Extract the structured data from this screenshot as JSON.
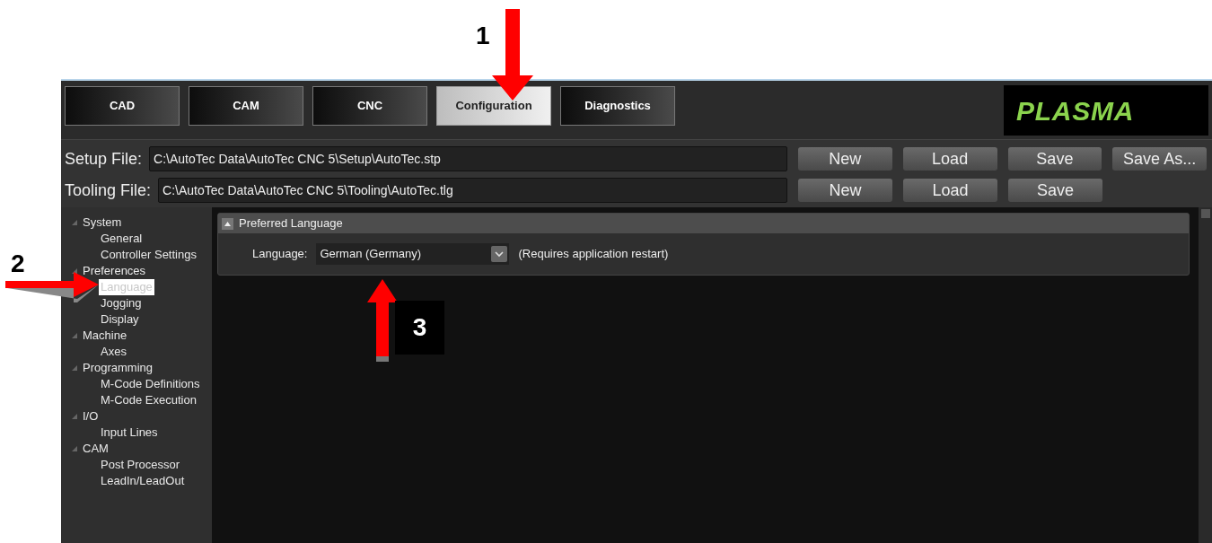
{
  "tabs": [
    {
      "label": "CAD",
      "selected": false
    },
    {
      "label": "CAM",
      "selected": false
    },
    {
      "label": "CNC",
      "selected": false
    },
    {
      "label": "Configuration",
      "selected": true
    },
    {
      "label": "Diagnostics",
      "selected": false
    }
  ],
  "logo": "PLASMA",
  "files": [
    {
      "label": "Setup File:",
      "path": "C:\\AutoTec Data\\AutoTec CNC 5\\Setup\\AutoTec.stp",
      "buttons": [
        "New",
        "Load",
        "Save",
        "Save As..."
      ]
    },
    {
      "label": "Tooling File:",
      "path": "C:\\AutoTec Data\\AutoTec CNC 5\\Tooling\\AutoTec.tlg",
      "buttons": [
        "New",
        "Load",
        "Save"
      ]
    }
  ],
  "tree": [
    {
      "label": "System",
      "expanded": true,
      "children": [
        {
          "label": "General",
          "selected": false
        },
        {
          "label": "Controller Settings",
          "selected": false
        }
      ]
    },
    {
      "label": "Preferences",
      "expanded": true,
      "children": [
        {
          "label": "Language",
          "selected": true
        },
        {
          "label": "Jogging",
          "selected": false
        },
        {
          "label": "Display",
          "selected": false
        }
      ]
    },
    {
      "label": "Machine",
      "expanded": true,
      "children": [
        {
          "label": "Axes",
          "selected": false
        }
      ]
    },
    {
      "label": "Programming",
      "expanded": true,
      "children": [
        {
          "label": "M-Code Definitions",
          "selected": false
        },
        {
          "label": "M-Code Execution",
          "selected": false
        }
      ]
    },
    {
      "label": "I/O",
      "expanded": true,
      "children": [
        {
          "label": "Input Lines",
          "selected": false
        }
      ]
    },
    {
      "label": "CAM",
      "expanded": true,
      "children": [
        {
          "label": "Post Processor",
          "selected": false
        },
        {
          "label": "LeadIn/LeadOut",
          "selected": false
        }
      ]
    }
  ],
  "panel": {
    "title": "Preferred Language",
    "expanded": true,
    "field_label": "Language:",
    "value": "German (Germany)",
    "note": "(Requires application restart)"
  },
  "callouts": [
    "1",
    "2",
    "3"
  ]
}
